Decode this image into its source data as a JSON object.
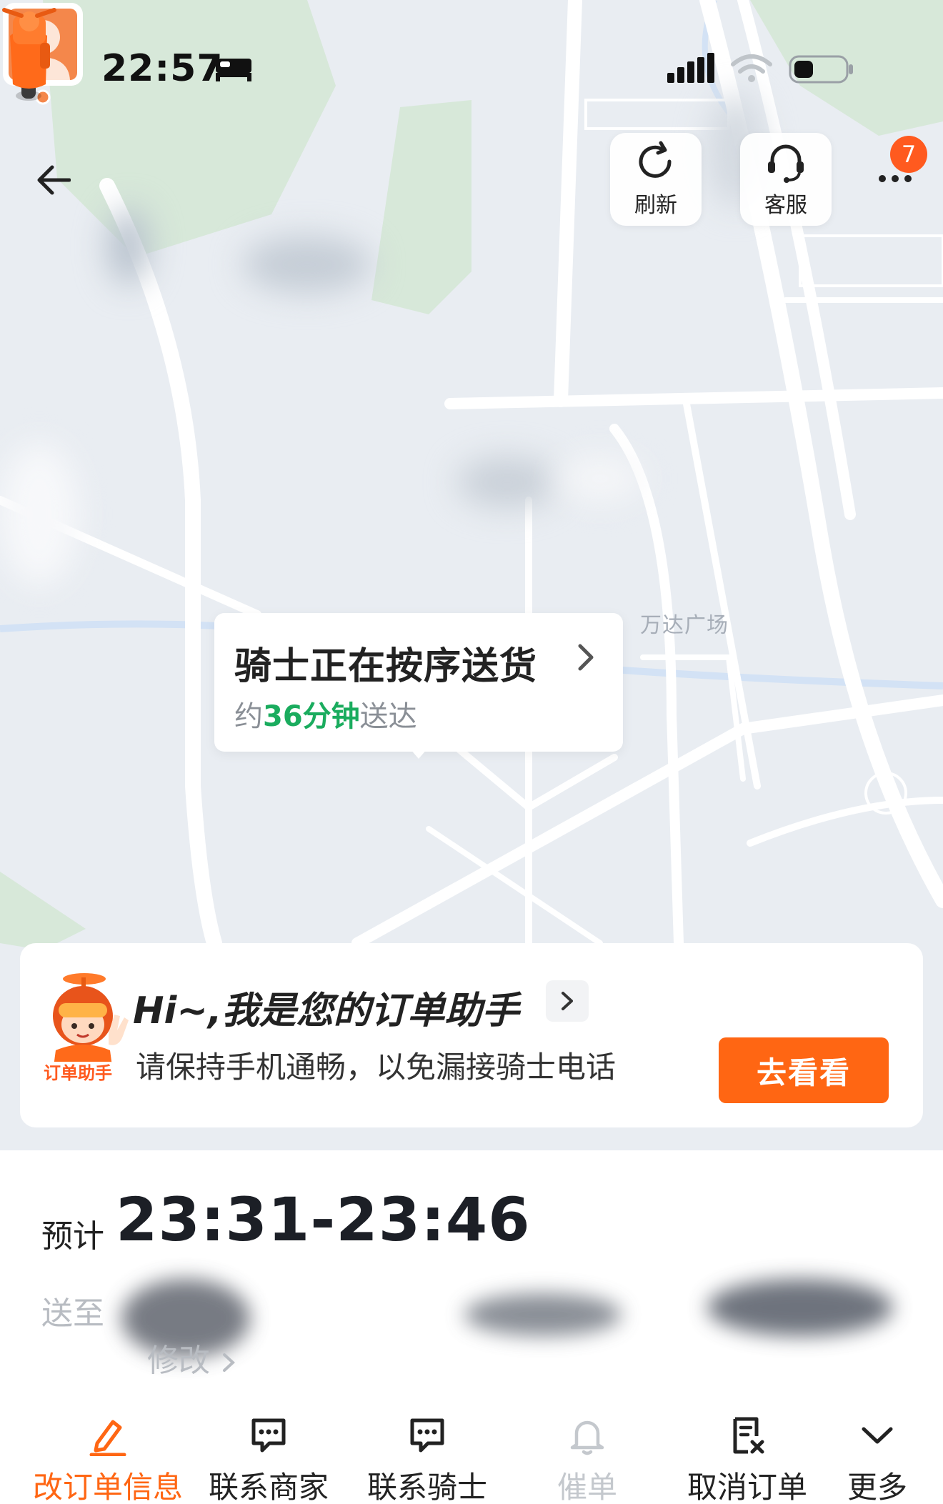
{
  "status_bar": {
    "time": "22:57"
  },
  "nav": {
    "refresh_label": "刷新",
    "service_label": "客服",
    "badge_count": "7"
  },
  "map": {
    "place_label": "万达广场"
  },
  "bubble": {
    "title": "骑士正在按序送货",
    "prefix": "约",
    "eta": "36分钟",
    "suffix": "送达"
  },
  "assistant": {
    "title": "Hi~,我是您的订单助手",
    "tag": "订单助手",
    "message": "请保持手机通畅，以免漏接骑士电话",
    "button": "去看看"
  },
  "order": {
    "eta_prefix": "预计",
    "eta_range": "23:31-23:46",
    "address_label": "送至",
    "edit_label": "修改"
  },
  "actions": [
    {
      "label": "改订单信息"
    },
    {
      "label": "联系商家"
    },
    {
      "label": "联系骑士"
    },
    {
      "label": "催单"
    },
    {
      "label": "取消订单"
    },
    {
      "label": "更多"
    }
  ],
  "colors": {
    "accent": "#ff6613",
    "eta_green": "#1aac5e",
    "badge": "#ff5a1f"
  }
}
